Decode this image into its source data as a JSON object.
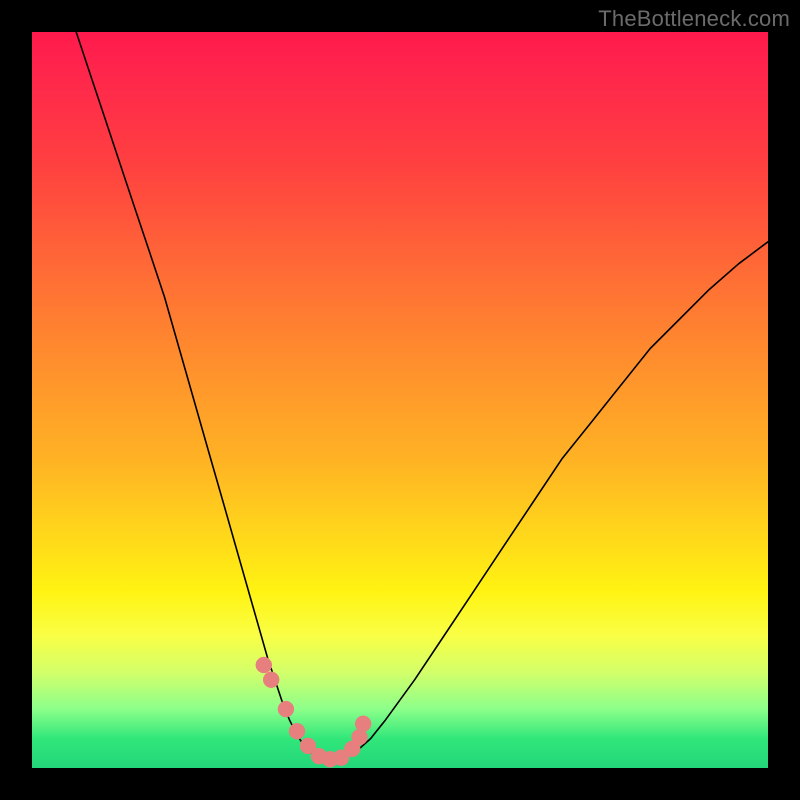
{
  "watermark": "TheBottleneck.com",
  "chart_data": {
    "type": "line",
    "title": "",
    "xlabel": "",
    "ylabel": "",
    "xlim": [
      0,
      100
    ],
    "ylim": [
      0,
      100
    ],
    "grid": false,
    "legend": false,
    "series": [
      {
        "name": "curve",
        "x": [
          6,
          8,
          10,
          12,
          14,
          16,
          18,
          20,
          22,
          24,
          26,
          28,
          30,
          32,
          33,
          34,
          35,
          36,
          37,
          38,
          39,
          40,
          41,
          42,
          44,
          46,
          48,
          52,
          56,
          60,
          64,
          68,
          72,
          76,
          80,
          84,
          88,
          92,
          96,
          100
        ],
        "y": [
          100,
          94,
          88,
          82,
          76,
          70,
          64,
          57,
          50,
          43,
          36,
          29,
          22,
          15,
          12,
          9,
          6.5,
          4.5,
          3,
          2,
          1.3,
          1,
          1,
          1.3,
          2.2,
          4,
          6.5,
          12,
          18,
          24,
          30,
          36,
          42,
          47,
          52,
          57,
          61,
          65,
          68.5,
          71.5
        ]
      }
    ],
    "markers": {
      "name": "highlight-points",
      "x": [
        31.5,
        32.5,
        34.5,
        36,
        37.5,
        39,
        40.5,
        42,
        43.5,
        44.5,
        45
      ],
      "y": [
        14,
        12,
        8,
        5,
        3,
        1.6,
        1.2,
        1.4,
        2.6,
        4.2,
        6
      ]
    },
    "background": {
      "type": "vertical-gradient",
      "stops": [
        {
          "pos": 0.0,
          "color": "#ff1a4d"
        },
        {
          "pos": 0.35,
          "color": "#ff7a30"
        },
        {
          "pos": 0.65,
          "color": "#ffd61b"
        },
        {
          "pos": 0.82,
          "color": "#f9ff45"
        },
        {
          "pos": 0.92,
          "color": "#8cff8a"
        },
        {
          "pos": 1.0,
          "color": "#22d67a"
        }
      ]
    }
  },
  "colors": {
    "curve": "#000000",
    "marker": "#e77f7f",
    "frame": "#000000"
  }
}
